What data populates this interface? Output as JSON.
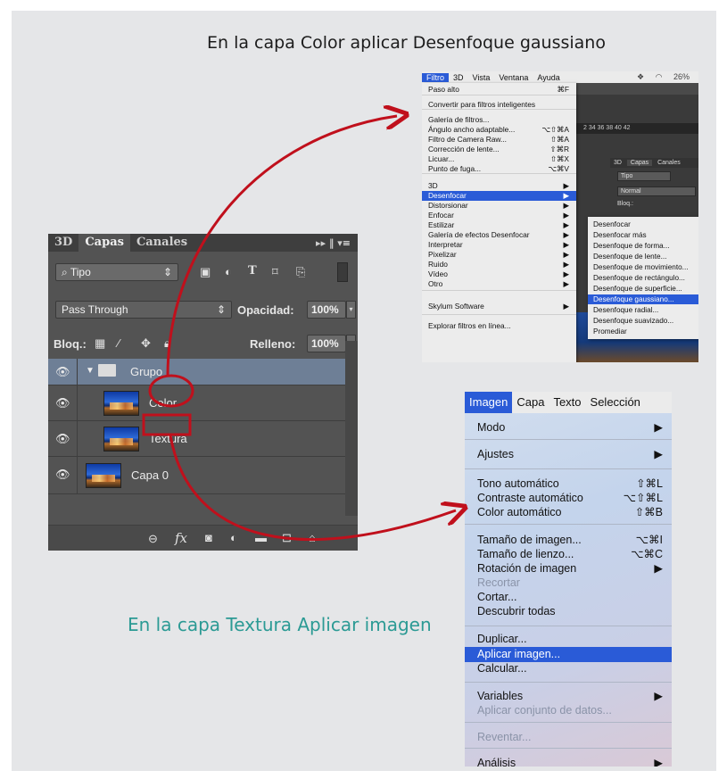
{
  "captions": {
    "top": "En la capa Color aplicar Desenfoque gaussiano",
    "bottom": "En la capa Textura Aplicar imagen"
  },
  "layers_panel": {
    "tabs": [
      "3D",
      "Capas",
      "Canales"
    ],
    "active_tab": "Capas",
    "filter_kind": "Tipo",
    "blend_mode": "Pass Through",
    "opacity_label": "Opacidad:",
    "opacity_value": "100%",
    "lock_label": "Bloq.:",
    "fill_label": "Relleno:",
    "fill_value": "100%",
    "layers": [
      {
        "name": "Grupo",
        "type": "group",
        "selected": true
      },
      {
        "name": "Color",
        "type": "layer",
        "selected": false
      },
      {
        "name": "Textura",
        "type": "layer",
        "selected": false
      },
      {
        "name": "Capa 0",
        "type": "layer",
        "selected": false
      }
    ],
    "bottom_icons": [
      "link-icon",
      "fx-icon",
      "mask-icon",
      "adjustment-icon",
      "folder-icon",
      "new-layer-icon",
      "trash-icon"
    ]
  },
  "filter_screenshot": {
    "menubar": [
      "Filtro",
      "3D",
      "Vista",
      "Ventana",
      "Ayuda"
    ],
    "active_menu": "Filtro",
    "status_text": "26%",
    "menu_items": [
      {
        "label": "Paso alto",
        "shortcut": "⌘F"
      },
      {
        "label": "Convertir para filtros inteligentes",
        "shortcut": ""
      },
      {
        "label": "Galería de filtros...",
        "shortcut": ""
      },
      {
        "label": "Ángulo ancho adaptable...",
        "shortcut": "⌥⇧⌘A"
      },
      {
        "label": "Filtro de Camera Raw...",
        "shortcut": "⇧⌘A"
      },
      {
        "label": "Corrección de lente...",
        "shortcut": "⇧⌘R"
      },
      {
        "label": "Licuar...",
        "shortcut": "⇧⌘X"
      },
      {
        "label": "Punto de fuga...",
        "shortcut": "⌥⌘V"
      },
      {
        "label": "3D",
        "shortcut": "▶"
      },
      {
        "label": "Desenfocar",
        "shortcut": "▶"
      },
      {
        "label": "Distorsionar",
        "shortcut": "▶"
      },
      {
        "label": "Enfocar",
        "shortcut": "▶"
      },
      {
        "label": "Estilizar",
        "shortcut": "▶"
      },
      {
        "label": "Galería de efectos Desenfocar",
        "shortcut": "▶"
      },
      {
        "label": "Interpretar",
        "shortcut": "▶"
      },
      {
        "label": "Pixelizar",
        "shortcut": "▶"
      },
      {
        "label": "Ruido",
        "shortcut": "▶"
      },
      {
        "label": "Vídeo",
        "shortcut": "▶"
      },
      {
        "label": "Otro",
        "shortcut": "▶"
      },
      {
        "label": "Skylum Software",
        "shortcut": "▶"
      },
      {
        "label": "Explorar filtros en línea...",
        "shortcut": ""
      }
    ],
    "submenu_items": [
      "Desenfocar",
      "Desenfocar más",
      "Desenfoque de forma...",
      "Desenfoque de lente...",
      "Desenfoque de movimiento...",
      "Desenfoque de rectángulo...",
      "Desenfoque de superficie...",
      "Desenfoque gaussiano...",
      "Desenfoque radial...",
      "Desenfoque suavizado...",
      "Promediar"
    ],
    "bg_panel_tabs": [
      "3D",
      "Capas",
      "Canales"
    ],
    "bg_ruler": "2  34  36  38  40  42",
    "bg_kind": "Tipo",
    "bg_blend": "Normal",
    "bg_lock": "Bloq.:"
  },
  "image_menu": {
    "menubar": [
      "Imagen",
      "Capa",
      "Texto",
      "Selección"
    ],
    "active_menu": "Imagen",
    "items": [
      {
        "label": "Modo",
        "shortcut": "▶",
        "disabled": false
      },
      {
        "label": "Ajustes",
        "shortcut": "▶",
        "disabled": false
      },
      {
        "label": "Tono automático",
        "shortcut": "⇧⌘L",
        "disabled": false
      },
      {
        "label": "Contraste automático",
        "shortcut": "⌥⇧⌘L",
        "disabled": false
      },
      {
        "label": "Color automático",
        "shortcut": "⇧⌘B",
        "disabled": false
      },
      {
        "label": "Tamaño de imagen...",
        "shortcut": "⌥⌘I",
        "disabled": false
      },
      {
        "label": "Tamaño de lienzo...",
        "shortcut": "⌥⌘C",
        "disabled": false
      },
      {
        "label": "Rotación de imagen",
        "shortcut": "▶",
        "disabled": false
      },
      {
        "label": "Recortar",
        "shortcut": "",
        "disabled": true
      },
      {
        "label": "Cortar...",
        "shortcut": "",
        "disabled": false
      },
      {
        "label": "Descubrir todas",
        "shortcut": "",
        "disabled": false
      },
      {
        "label": "Duplicar...",
        "shortcut": "",
        "disabled": false
      },
      {
        "label": "Aplicar imagen...",
        "shortcut": "",
        "disabled": false
      },
      {
        "label": "Calcular...",
        "shortcut": "",
        "disabled": false
      },
      {
        "label": "Variables",
        "shortcut": "▶",
        "disabled": false
      },
      {
        "label": "Aplicar conjunto de datos...",
        "shortcut": "",
        "disabled": true
      },
      {
        "label": "Reventar...",
        "shortcut": "",
        "disabled": true
      },
      {
        "label": "Análisis",
        "shortcut": "▶",
        "disabled": false
      }
    ]
  },
  "colors": {
    "accent_blue": "#2a5bd7",
    "annotation_red": "#c0101c",
    "caption_teal": "#2b9a94",
    "ps_panel": "#535353",
    "ps_selected": "#6e7f96"
  }
}
